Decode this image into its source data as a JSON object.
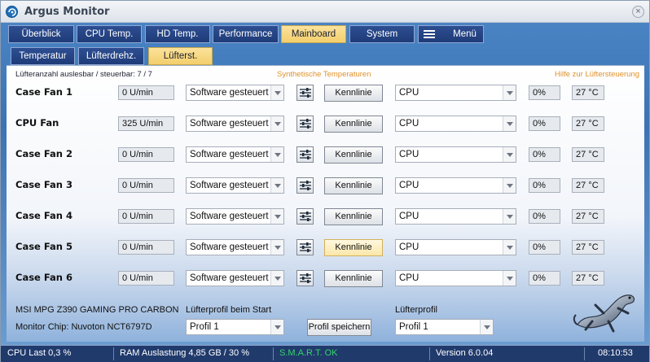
{
  "window": {
    "title": "Argus Monitor",
    "close_glyph": "×"
  },
  "main_tabs": [
    {
      "label": "Überblick",
      "active": false
    },
    {
      "label": "CPU Temp.",
      "active": false
    },
    {
      "label": "HD Temp.",
      "active": false
    },
    {
      "label": "Performance",
      "active": false
    },
    {
      "label": "Mainboard",
      "active": true
    },
    {
      "label": "System",
      "active": false
    },
    {
      "label": "Menü",
      "active": false,
      "icon": "hamburger-icon"
    }
  ],
  "sub_tabs": [
    {
      "label": "Temperatur",
      "active": false
    },
    {
      "label": "Lüfterdrehz.",
      "active": false
    },
    {
      "label": "Lüfterst.",
      "active": true
    }
  ],
  "header": {
    "fan_count": "Lüfteranzahl auslesbar / steuerbar: 7 / 7",
    "synthetic_link": "Synthetische Temperaturen",
    "help_link": "Hilfe zur Lüftersteuerung"
  },
  "fans": [
    {
      "name": "Case Fan 1",
      "rpm": "0 U/min",
      "mode": "Software gesteuert",
      "curve_label": "Kennlinie",
      "source": "CPU",
      "percent": "0%",
      "temp": "27 °C"
    },
    {
      "name": "CPU Fan",
      "rpm": "325 U/min",
      "mode": "Software gesteuert",
      "curve_label": "Kennlinie",
      "source": "CPU",
      "percent": "0%",
      "temp": "27 °C"
    },
    {
      "name": "Case Fan 2",
      "rpm": "0 U/min",
      "mode": "Software gesteuert",
      "curve_label": "Kennlinie",
      "source": "CPU",
      "percent": "0%",
      "temp": "27 °C"
    },
    {
      "name": "Case Fan 3",
      "rpm": "0 U/min",
      "mode": "Software gesteuert",
      "curve_label": "Kennlinie",
      "source": "CPU",
      "percent": "0%",
      "temp": "27 °C"
    },
    {
      "name": "Case Fan 4",
      "rpm": "0 U/min",
      "mode": "Software gesteuert",
      "curve_label": "Kennlinie",
      "source": "CPU",
      "percent": "0%",
      "temp": "27 °C"
    },
    {
      "name": "Case Fan 5",
      "rpm": "0 U/min",
      "mode": "Software gesteuert",
      "curve_label": "Kennlinie",
      "source": "CPU",
      "percent": "0%",
      "temp": "27 °C"
    },
    {
      "name": "Case Fan 6",
      "rpm": "0 U/min",
      "mode": "Software gesteuert",
      "curve_label": "Kennlinie",
      "source": "CPU",
      "percent": "0%",
      "temp": "27 °C"
    }
  ],
  "footer": {
    "board": "MSI MPG Z390 GAMING PRO CARBON",
    "chip": "Monitor Chip: Nuvoton NCT6797D",
    "start_profile_label": "Lüfterprofil beim Start",
    "start_profile_value": "Profil 1",
    "save_profile_button": "Profil speichern",
    "profile_label": "Lüfterprofil",
    "profile_value": "Profil 1"
  },
  "status": {
    "cpu": "CPU Last 0,3 %",
    "ram": "RAM Auslastung 4,85 GB / 30 %",
    "smart": "S.M.A.R.T. OK",
    "version": "Version 6.0.04",
    "time": "08:10:53"
  },
  "colors": {
    "tab_active": "#f3cf6c",
    "tab_inactive": "#1f3b78",
    "smart_ok": "#37d36a",
    "link_orange": "#e0922b"
  }
}
